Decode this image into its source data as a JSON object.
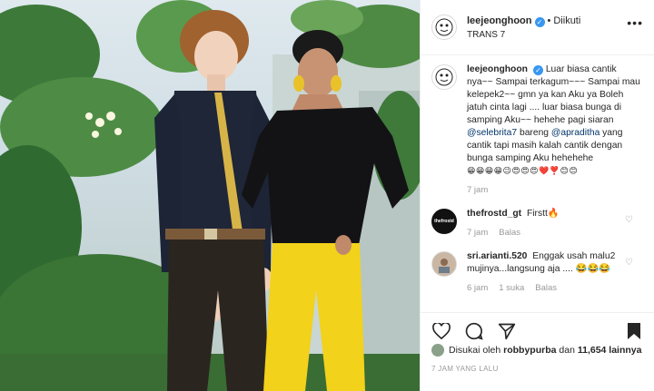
{
  "post": {
    "username": "leejeonghoon",
    "verified": true,
    "follow_status": "Diikuti",
    "location": "TRANS 7"
  },
  "caption": {
    "username": "leejeonghoon",
    "text_1": "Luar biasa cantik nya~~ Sampai terkagum~~~ Sampai mau kelepek2~~ gmn ya kan Aku ya Boleh jatuh cinta lagi .... luar biasa bunga di samping Aku~~ hehehe pagi siaran ",
    "mention_1": "@selebrita7",
    "text_2": " bareng ",
    "mention_2": "@apraditha",
    "text_3": " yang cantik tapi masih kalah cantik dengan bunga samping Aku hehehehe",
    "emojis": "😁😁😁😁😉😍😍😍❤️❣️😊😊",
    "time": "7 jam"
  },
  "comments": [
    {
      "username": "thefrostd_gt",
      "text": "Firstt🔥",
      "time": "7 jam",
      "likes": "",
      "reply": "Balas",
      "avatar_text": "thefrostd"
    },
    {
      "username": "sri.arianti.520",
      "text": "Enggak usah malu2 mujinya...langsung aja .... 😂😂😂",
      "time": "6 jam",
      "likes": "1 suka",
      "reply": "Balas"
    }
  ],
  "likes": {
    "prefix": "Disukai oleh",
    "user": "robbypurba",
    "middle": "dan",
    "count": "11,654 lainnya"
  },
  "timestamp": "7 JAM YANG LALU",
  "icons": {
    "more": "more-icon",
    "like": "heart-icon",
    "comment": "comment-icon",
    "share": "share-icon",
    "save": "bookmark-icon"
  },
  "colors": {
    "accent_blue": "#3897f0",
    "mention": "#003569",
    "muted": "#999999",
    "border": "#efefef",
    "yellow_pants": "#f2d21a"
  }
}
